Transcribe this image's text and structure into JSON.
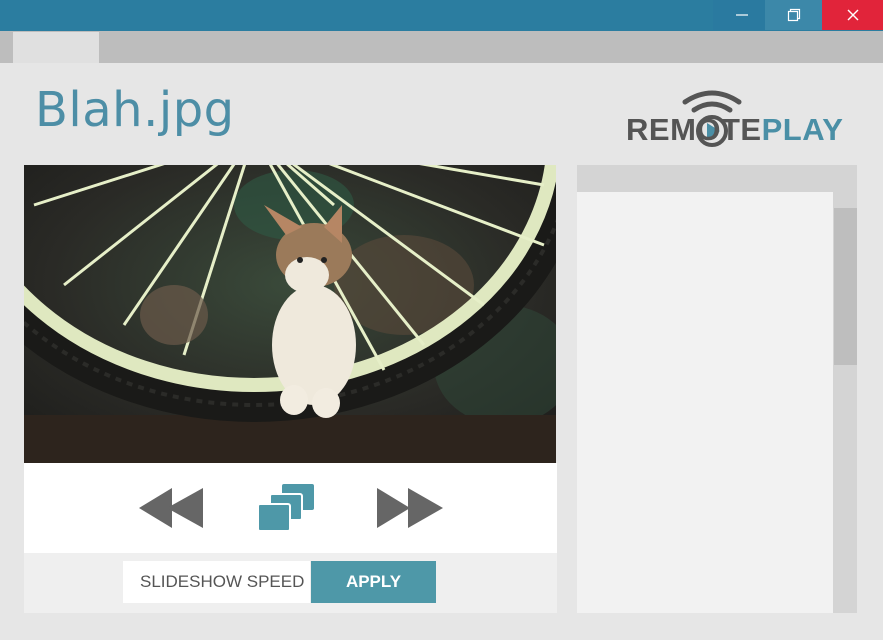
{
  "window": {
    "controls": [
      "minimize",
      "restore",
      "close"
    ],
    "titlebar_color": "#2b7da0",
    "close_color": "#e1243a"
  },
  "tabs": [
    {
      "label": ""
    }
  ],
  "file": {
    "name": "Blah.jpg"
  },
  "logo": {
    "part1": "REMOTE",
    "part2": "PLAY",
    "icon": "wifi-play-icon"
  },
  "image": {
    "description_icon": "photo-kitten-bicycle-wheel"
  },
  "controls": {
    "previous_icon": "rewind-icon",
    "slideshow_icon": "slideshow-icon",
    "next_icon": "fast-forward-icon"
  },
  "slideshow": {
    "speed_placeholder": "SLIDESHOW SPEED",
    "apply_label": "APPLY"
  },
  "colors": {
    "accent": "#4e98a8",
    "title_text": "#4d8ea6",
    "control_icons": "#666666"
  }
}
